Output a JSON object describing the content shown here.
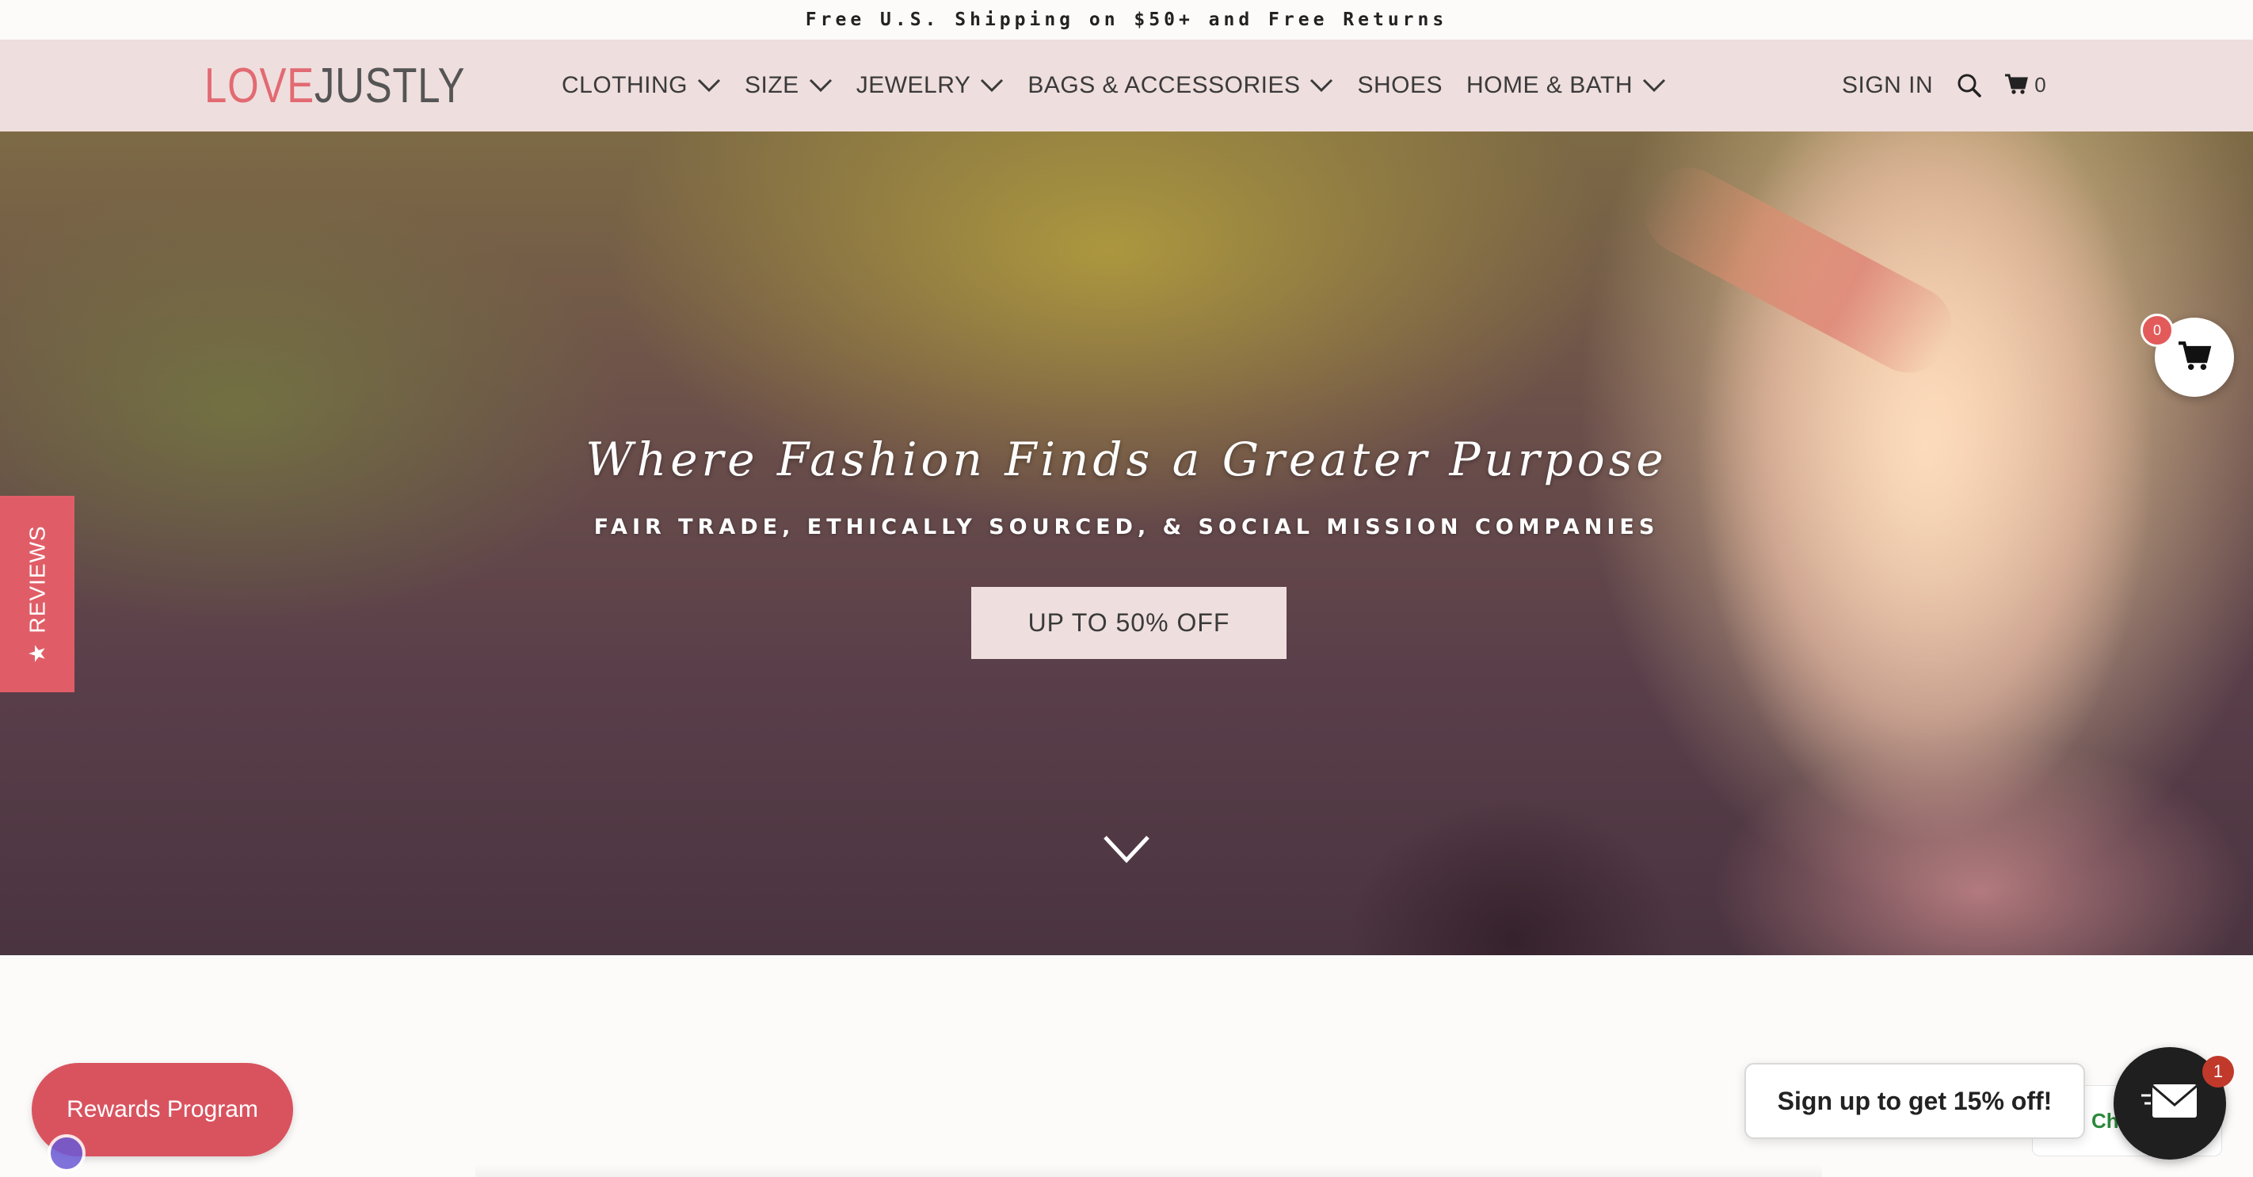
{
  "announcement": {
    "text": "Free U.S. Shipping on $50+ and Free Returns"
  },
  "header": {
    "logo_part1": "LOVE",
    "logo_part2": "JUSTLY",
    "nav": [
      {
        "label": "CLOTHING",
        "has_dropdown": true
      },
      {
        "label": "SIZE",
        "has_dropdown": true
      },
      {
        "label": "JEWELRY",
        "has_dropdown": true
      },
      {
        "label": "BAGS & ACCESSORIES",
        "has_dropdown": true
      },
      {
        "label": "SHOES",
        "has_dropdown": false
      },
      {
        "label": "HOME & BATH",
        "has_dropdown": true
      }
    ],
    "sign_in": "SIGN IN",
    "search_icon": "search-icon",
    "cart_icon": "cart-icon",
    "cart_count": "0"
  },
  "hero": {
    "title": "Where Fashion Finds a Greater Purpose",
    "subtitle": "FAIR TRADE, ETHICALLY SOURCED, & SOCIAL MISSION COMPANIES",
    "cta": "UP TO 50% OFF",
    "scroll_icon": "chevron-down-icon"
  },
  "reviews_tab": {
    "star": "★",
    "label": "REVIEWS"
  },
  "floating_cart": {
    "count": "0",
    "icon": "cart-icon"
  },
  "rewards": {
    "label": "Rewards Program"
  },
  "signup": {
    "label": "Sign up to get 15% off!",
    "badge": "1",
    "icon": "envelope-icon"
  },
  "chat": {
    "label": "Ch"
  },
  "colors": {
    "header_bg": "#efdede",
    "logo_accent": "#e26a72",
    "reviews_tab": "#e05d67",
    "rewards": "#d9535f",
    "mail_button": "#1f1f1f"
  }
}
